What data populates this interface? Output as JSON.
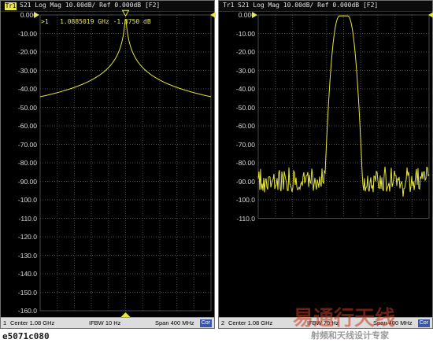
{
  "panels": [
    {
      "trace_id": "Tr1",
      "header": "S21 Log Mag 10.00dB/ Ref 0.000dB [F2]",
      "y_labels": [
        "0.000",
        "-10.00",
        "-20.00",
        "-30.00",
        "-40.00",
        "-50.00",
        "-60.00",
        "-70.00",
        "-80.00",
        "-90.00",
        "-100.0",
        "-110.0",
        "-120.0",
        "-130.0",
        "-140.0",
        "-150.0",
        "-160.0"
      ],
      "marker_readout": ">1   1.0885019 GHz -1.3750 dB",
      "status": {
        "channel": "1",
        "center": "Center 1.08 GHz",
        "ifbw": "IFBW 10 Hz",
        "span": "Span 400 MHz",
        "cor": "Cor"
      },
      "trace_color": "#e6e63c"
    },
    {
      "trace_id": "Tr1",
      "header": "S21 Log Mag 10.00dB/ Ref 0.000dB [F2]",
      "y_labels": [
        "0.000",
        "-10.00",
        "-20.00",
        "-30.00",
        "-40.00",
        "-50.00",
        "-60.00",
        "-70.00",
        "-80.00",
        "-90.00",
        "-100.0",
        "-110.0"
      ],
      "status": {
        "channel": "2",
        "center": "Center 1.08 GHz",
        "ifbw": "IFBW 70 Hz",
        "span": "Span 400 MHz",
        "cor": "Cor"
      },
      "trace_color": "#e6e63c"
    }
  ],
  "model_label": "e5071c080",
  "watermark": {
    "main": "易通行天线",
    "sub": "射频和天线设计专家"
  },
  "colors": {
    "trace": "#e6e63c",
    "grid": "#4a4a4a",
    "background": "#000000"
  }
}
